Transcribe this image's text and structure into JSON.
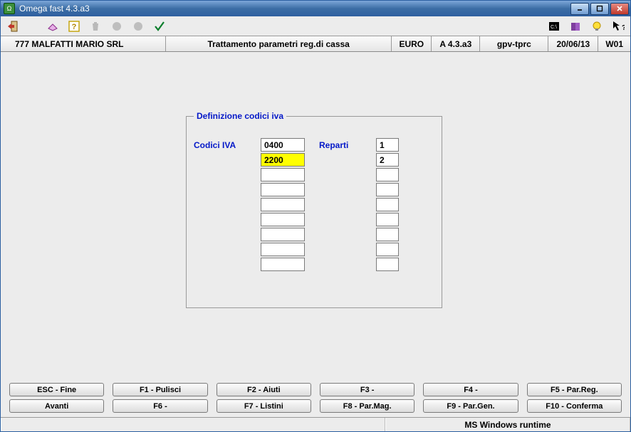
{
  "title": "Omega fast  4.3.a3",
  "infobar": {
    "company": "777 MALFATTI MARIO SRL",
    "module": "Trattamento parametri reg.di cassa",
    "currency": "EURO",
    "version": "A 4.3.a3",
    "program": "gpv-tprc",
    "date": "20/06/13",
    "terminal": "W01"
  },
  "groupbox": {
    "legend": "Definizione codici iva",
    "col1_label": "Codici IVA",
    "col2_label": "Reparti",
    "codici": [
      "0400",
      "2200",
      "",
      "",
      "",
      "",
      "",
      "",
      ""
    ],
    "reparti": [
      "1",
      "2",
      "",
      "",
      "",
      "",
      "",
      "",
      ""
    ],
    "selected_index": 1
  },
  "fkeys": {
    "r1c1": "ESC - Fine",
    "r1c2": "F1 - Pulisci",
    "r1c3": "F2 -  Aiuti",
    "r1c4": "F3 -",
    "r1c5": "F4 -",
    "r1c6": "F5 - Par.Reg.",
    "r2c1": "Avanti",
    "r2c2": "F6 -",
    "r2c3": "F7 - Listini",
    "r2c4": "F8 - Par.Mag.",
    "r2c5": "F9 - Par.Gen.",
    "r2c6": "F10 - Conferma"
  },
  "status": {
    "runtime": "MS Windows runtime"
  }
}
